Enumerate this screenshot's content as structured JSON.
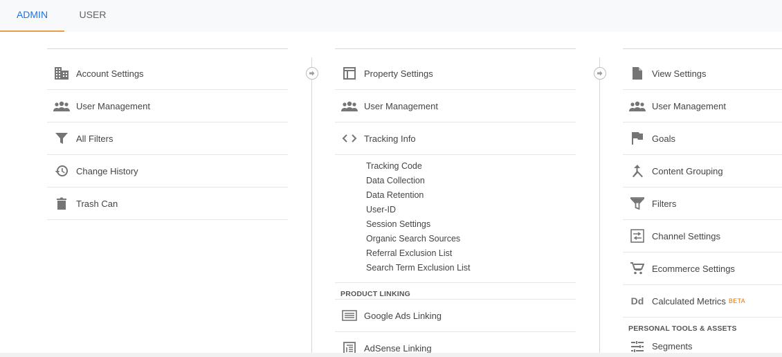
{
  "tabs": {
    "admin": "ADMIN",
    "user": "USER"
  },
  "colors": {
    "accent": "#1a73e8",
    "tab_underline": "#e8a04a",
    "icon": "#757575",
    "beta": "#e37400"
  },
  "account": {
    "items": [
      {
        "label": "Account Settings",
        "icon": "building-icon"
      },
      {
        "label": "User Management",
        "icon": "people-icon"
      },
      {
        "label": "All Filters",
        "icon": "filter-icon"
      },
      {
        "label": "Change History",
        "icon": "history-icon"
      },
      {
        "label": "Trash Can",
        "icon": "trash-icon"
      }
    ]
  },
  "property": {
    "items": [
      {
        "label": "Property Settings",
        "icon": "layout-icon"
      },
      {
        "label": "User Management",
        "icon": "people-icon"
      },
      {
        "label": "Tracking Info",
        "icon": "code-icon"
      }
    ],
    "tracking_sub": [
      "Tracking Code",
      "Data Collection",
      "Data Retention",
      "User-ID",
      "Session Settings",
      "Organic Search Sources",
      "Referral Exclusion List",
      "Search Term Exclusion List"
    ],
    "product_linking": {
      "title": "PRODUCT LINKING",
      "items": [
        {
          "label": "Google Ads Linking",
          "icon": "ads-icon"
        },
        {
          "label": "AdSense Linking",
          "icon": "adsense-icon"
        }
      ]
    }
  },
  "view": {
    "items": [
      {
        "label": "View Settings",
        "icon": "document-icon"
      },
      {
        "label": "User Management",
        "icon": "people-icon"
      },
      {
        "label": "Goals",
        "icon": "flag-icon"
      },
      {
        "label": "Content Grouping",
        "icon": "grouping-icon"
      },
      {
        "label": "Filters",
        "icon": "filter-icon"
      },
      {
        "label": "Channel Settings",
        "icon": "channel-icon"
      },
      {
        "label": "Ecommerce Settings",
        "icon": "cart-icon"
      },
      {
        "label": "Calculated Metrics",
        "icon": "dd-icon",
        "badge": "BETA"
      }
    ],
    "personal": {
      "title": "PERSONAL TOOLS & ASSETS",
      "items": [
        {
          "label": "Segments",
          "icon": "segments-icon"
        }
      ]
    }
  }
}
